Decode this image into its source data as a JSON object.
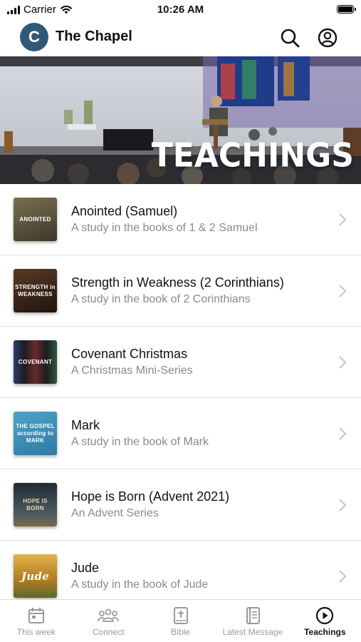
{
  "status_bar": {
    "carrier": "Carrier",
    "time": "10:26 AM"
  },
  "header": {
    "logo_letter": "C",
    "title": "The Chapel",
    "search_icon": "search-icon",
    "account_icon": "account-circle-icon"
  },
  "hero": {
    "title": "TEACHINGS"
  },
  "teachings": [
    {
      "title": "Anointed (Samuel)",
      "subtitle": "A study in the books of 1 & 2 Samuel",
      "thumb_text": "ANOINTED",
      "thumb_color": "#5a5340"
    },
    {
      "title": "Strength in Weakness (2 Corinthians)",
      "subtitle": "A study in the book of 2 Corinthians",
      "thumb_text": "STRENGTH in WEAKNESS",
      "thumb_color": "#3d2a1f"
    },
    {
      "title": "Covenant Christmas",
      "subtitle": "A Christmas Mini-Series",
      "thumb_text": "COVENANT",
      "thumb_color": "#1c1c22"
    },
    {
      "title": "Mark",
      "subtitle": "A study in the book of Mark",
      "thumb_text": "THE GOSPEL according to MARK",
      "thumb_color": "#3f8fb8"
    },
    {
      "title": "Hope is Born (Advent 2021)",
      "subtitle": "An Advent Series",
      "thumb_text": "HOPE IS BORN",
      "thumb_color": "#2e3a44"
    },
    {
      "title": "Jude",
      "subtitle": "A study in the book of Jude",
      "thumb_text": "Jude",
      "thumb_color": "#c9962e"
    }
  ],
  "tabs": [
    {
      "label": "This week",
      "icon": "calendar-icon",
      "active": false
    },
    {
      "label": "Connect",
      "icon": "people-icon",
      "active": false
    },
    {
      "label": "Bible",
      "icon": "bible-icon",
      "active": false
    },
    {
      "label": "Latest Message",
      "icon": "book-icon",
      "active": false
    },
    {
      "label": "Teachings",
      "icon": "play-circle-icon",
      "active": true
    }
  ]
}
